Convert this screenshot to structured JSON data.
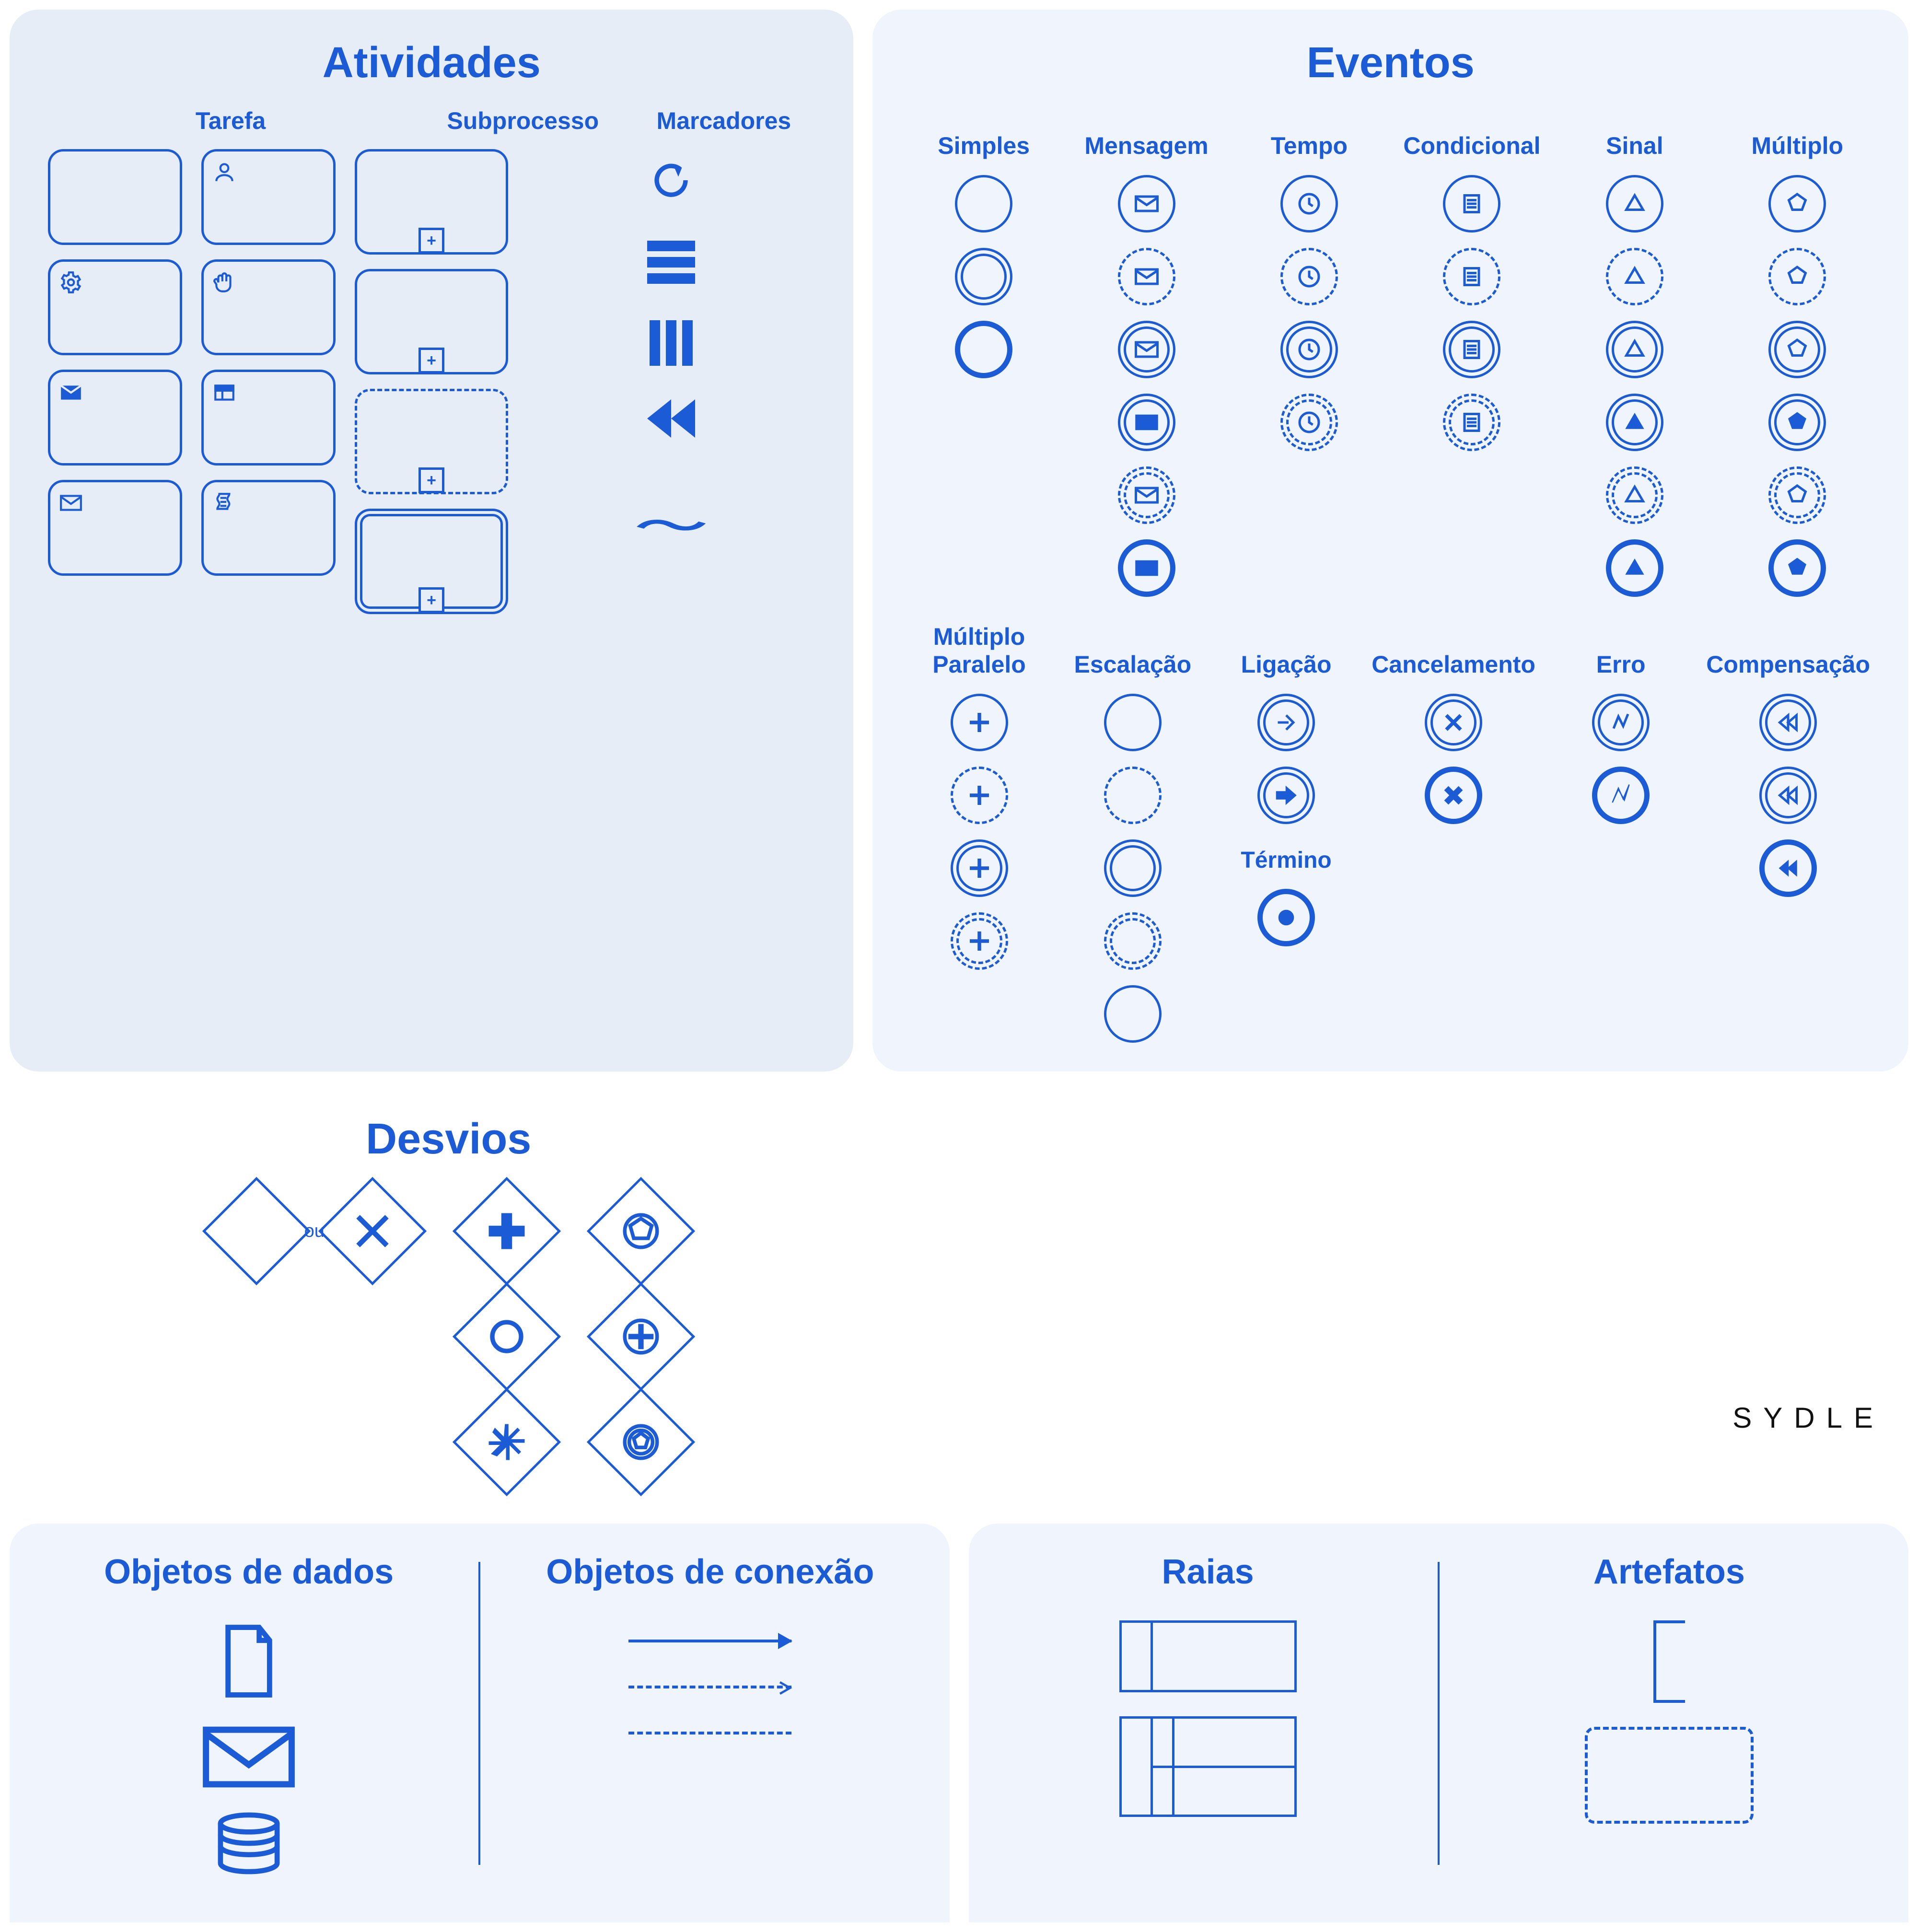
{
  "sections": {
    "atividades": "Atividades",
    "tarefa": "Tarefa",
    "subprocesso": "Subprocesso",
    "marcadores": "Marcadores",
    "eventos": "Eventos",
    "desvios": "Desvios",
    "objetos_dados": "Objetos de dados",
    "objetos_conexao": "Objetos de conexão",
    "raias": "Raias",
    "artefatos": "Artefatos"
  },
  "ou": "ou",
  "termino": "Término",
  "event_cols_top": [
    "Simples",
    "Mensagem",
    "Tempo",
    "Condicional",
    "Sinal",
    "Múltiplo"
  ],
  "event_cols_bottom": [
    "Múltiplo\nParalelo",
    "Escalação",
    "Ligação",
    "Cancelamento",
    "Erro",
    "Compensação"
  ],
  "tasks": {
    "plain": "task-none",
    "user": "task-user",
    "service": "task-service",
    "manual": "task-manual",
    "send": "task-send",
    "receive": "task-receive",
    "business_rule": "task-business-rule",
    "script": "task-script"
  },
  "subprocess": [
    "collapsed",
    "expanded",
    "adhoc-dashed",
    "event-thick"
  ],
  "markers": [
    "loop",
    "parallel-horizontal",
    "parallel-vertical",
    "compensation",
    "adhoc"
  ],
  "gateways": {
    "exclusive_plain": "exclusive-plain",
    "exclusive_x": "exclusive-x",
    "parallel_plus": "parallel",
    "event_pentagon": "event-based",
    "inclusive_circle": "inclusive",
    "parallel_event_plus": "parallel-event-based",
    "complex": "complex",
    "exclusive_event_pentagon": "exclusive-event-based"
  },
  "events_matrix": {
    "simples": [
      "start",
      "intermediate",
      "end"
    ],
    "mensagem": [
      "start-catch",
      "start-noninterrupt",
      "intermediate-catch",
      "intermediate-throw",
      "intermediate-noninterrupt",
      "end-throw"
    ],
    "tempo": [
      "start",
      "start-noninterrupt",
      "intermediate",
      "intermediate-noninterrupt"
    ],
    "condicional": [
      "start",
      "start-noninterrupt",
      "intermediate",
      "intermediate-noninterrupt"
    ],
    "sinal": [
      "start-catch",
      "start-noninterrupt",
      "intermediate-catch",
      "intermediate-throw",
      "intermediate-noninterrupt",
      "end-throw"
    ],
    "multiplo": [
      "start-catch",
      "start-noninterrupt",
      "intermediate-catch",
      "intermediate-throw",
      "intermediate-noninterrupt",
      "end-throw"
    ],
    "multiplo_paralelo": [
      "start",
      "start-noninterrupt",
      "intermediate",
      "intermediate-noninterrupt"
    ],
    "escalacao": [
      "start",
      "start-noninterrupt",
      "intermediate",
      "intermediate-noninterrupt",
      "end"
    ],
    "ligacao": [
      "catch",
      "throw"
    ],
    "cancelamento": [
      "intermediate",
      "end"
    ],
    "erro": [
      "intermediate",
      "end"
    ],
    "compensacao": [
      "intermediate-catch",
      "intermediate-throw",
      "end-throw"
    ],
    "termino": [
      "end"
    ]
  },
  "data_objects": [
    "data-object",
    "message",
    "data-store"
  ],
  "connections": [
    "sequence-flow",
    "message-flow",
    "association"
  ],
  "pools": [
    "pool",
    "pool-with-lanes"
  ],
  "artifacts": [
    "text-annotation",
    "group"
  ],
  "brand": "SYDLE"
}
